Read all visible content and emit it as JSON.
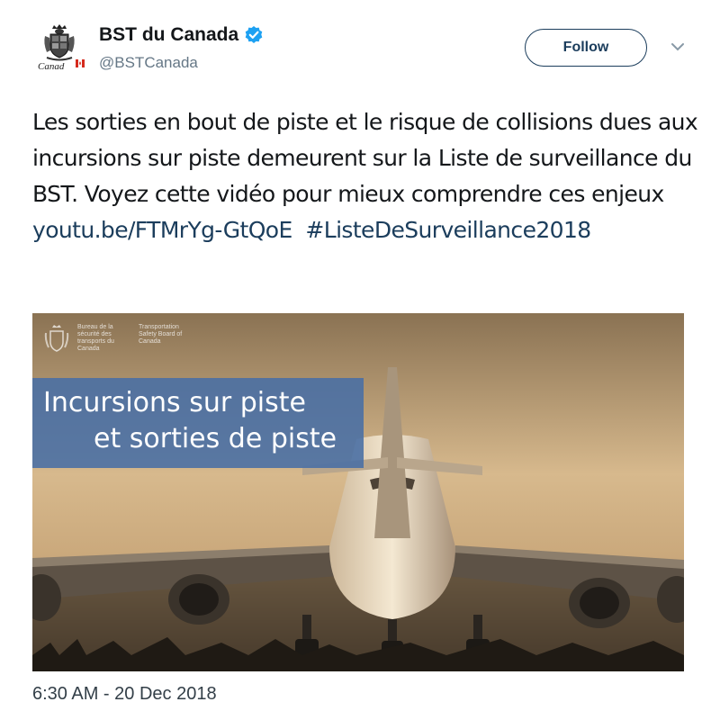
{
  "account": {
    "display_name": "BST du Canada",
    "handle": "@BSTCanada",
    "avatar_wordmark": "Canad"
  },
  "actions": {
    "follow_label": "Follow"
  },
  "tweet": {
    "text": "Les sorties en bout de piste et le risque de collisions dues aux incursions sur piste demeurent sur la Liste de surveillance du BST. Voyez cette vidéo pour mieux comprendre ces enjeux ",
    "link": "youtu.be/FTMrYg-GtQoE",
    "hashtag": "#ListeDeSurveillance2018",
    "timestamp": "6:30 AM - 20 Dec 2018"
  },
  "media": {
    "org_fr": "Bureau de la sécurité des transports du Canada",
    "org_en": "Transportation Safety Board of Canada",
    "title_line1": "Incursions sur piste",
    "title_line2": "et sorties de piste"
  },
  "colors": {
    "link": "#1b3d5c",
    "verified": "#1da1f2",
    "banner": "#486ea5"
  },
  "icons": {
    "verified": "verified-badge-icon",
    "chevron": "chevron-down-icon",
    "avatar": "canada-coat-of-arms"
  }
}
